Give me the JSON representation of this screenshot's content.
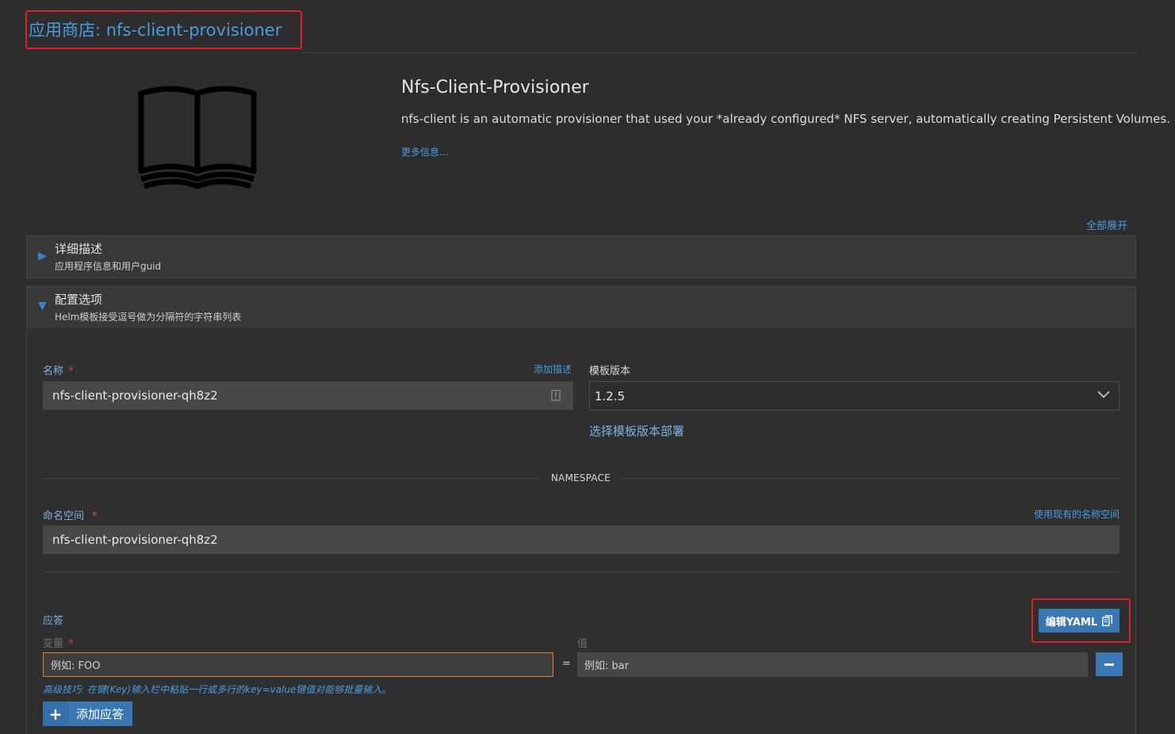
{
  "header": {
    "title": "应用商店: nfs-client-provisioner"
  },
  "app": {
    "icon": "book-icon",
    "name": "Nfs-Client-Provisioner",
    "description": "nfs-client is an automatic provisioner that used your *already configured* NFS server, automatically creating Persistent Volumes.",
    "more_info": "更多信息..."
  },
  "expand_all": "全部展开",
  "sections": [
    {
      "title": "详细描述",
      "subtitle": "应用程序信息和用户guid",
      "expanded": false
    },
    {
      "title": "配置选项",
      "subtitle": "Helm模板接受逗号做为分隔符的字符串列表",
      "expanded": true
    }
  ],
  "form": {
    "name_label": "名称",
    "required_mark": "*",
    "add_description": "添加描述",
    "name_value": "nfs-client-provisioner-qh8z2",
    "template_version_label": "模板版本",
    "template_version_value": "1.2.5",
    "select_template_deploy": "选择模板版本部署",
    "namespace_divider": "NAMESPACE",
    "namespace_label": "命名空间",
    "use_existing_namespace": "使用现有的名称空间",
    "namespace_value": "nfs-client-provisioner-qh8z2"
  },
  "answers": {
    "title": "应答",
    "edit_yaml": "编辑YAML",
    "variable_label": "变量",
    "value_label": "值",
    "variable_placeholder": "例如: FOO",
    "equals": "=",
    "value_placeholder": "例如: bar",
    "tip": "高级技巧: 在键(Key)输入栏中粘贴一行或多行的key=value键值对能够批量输入。",
    "add_answer": "添加应答"
  },
  "colors": {
    "accent": "#4a9be0",
    "button": "#3b78b3",
    "highlight": "#e0202a",
    "focus": "#e8822e"
  }
}
